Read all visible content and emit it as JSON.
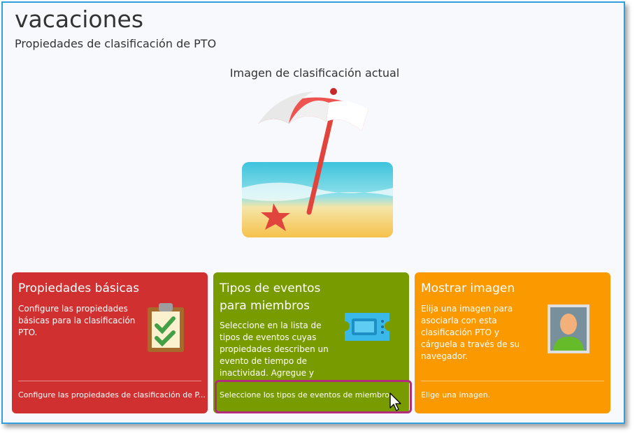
{
  "page": {
    "title": "vacaciones",
    "subtitle": "Propiedades de clasificación de PTO",
    "image_caption": "Imagen de clasificación actual",
    "hero_icon": "beach-umbrella-icon"
  },
  "cards": [
    {
      "title": "Propiedades básicas",
      "description": "Configure las propiedades básicas para la clasificación PTO.",
      "link": "Configure las propiedades de clasificación de P...",
      "icon": "clipboard-checklist-icon",
      "color": "#d03030"
    },
    {
      "title": "Tipos de eventos para miembros",
      "description": "Seleccione en la lista de tipos de eventos cuyas propiedades describen un evento de tiempo de inactividad. Agregue y",
      "link": "Seleccione los tipos de eventos de miembro.",
      "icon": "ticket-icon",
      "color": "#789b00"
    },
    {
      "title": "Mostrar imagen",
      "description": "Elija una imagen para asociarla con esta clasificación PTO y cárguela a través de su navegador.",
      "link": "Elige una imagen.",
      "icon": "user-photo-icon",
      "color": "#fa9900"
    }
  ]
}
